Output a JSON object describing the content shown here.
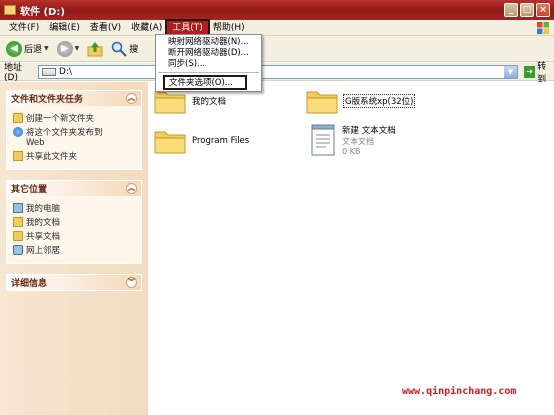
{
  "window": {
    "title": "软件 (D:)"
  },
  "menubar": {
    "items": [
      "文件(F)",
      "编辑(E)",
      "查看(V)",
      "收藏(A)",
      "工具(T)",
      "帮助(H)"
    ],
    "active_index": 4
  },
  "toolbar": {
    "back": "后退",
    "search": "搜"
  },
  "address": {
    "label": "地址(D)",
    "value": "D:\\",
    "go": "转到"
  },
  "tools_menu": {
    "items": [
      "映射网络驱动器(N)...",
      "断开网络驱动器(D)...",
      "同步(S)..."
    ],
    "folder_options": "文件夹选项(O)..."
  },
  "taskpane": {
    "panel1": {
      "title": "文件和文件夹任务",
      "tasks": [
        "创建一个新文件夹",
        "将这个文件夹发布到",
        "Web",
        "共享此文件夹"
      ]
    },
    "panel2": {
      "title": "其它位置",
      "places": [
        "我的电脑",
        "我的文档",
        "共享文档",
        "网上邻居"
      ]
    },
    "panel3": {
      "title": "详细信息"
    }
  },
  "files": {
    "f1": {
      "name": "我的文档"
    },
    "f2": {
      "name": "G版系统xp(32位)"
    },
    "f3": {
      "name": "Program Files"
    },
    "f4": {
      "name": "新建 文本文档",
      "type": "文本文档",
      "size": "0 KB"
    }
  },
  "watermark": "www.qinpinchang.com"
}
